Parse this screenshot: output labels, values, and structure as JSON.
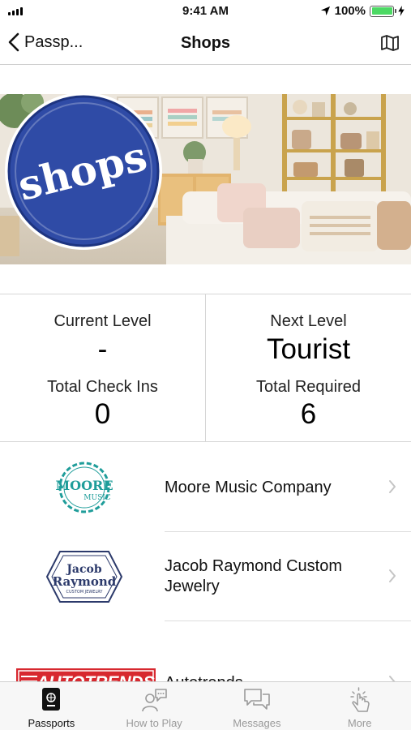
{
  "status_bar": {
    "time": "9:41 AM",
    "battery": "100%",
    "battery_level": 1.0
  },
  "nav": {
    "back_label": "Passp...",
    "title": "Shops",
    "map_icon": "map-icon"
  },
  "banner": {
    "badge_text": "shops",
    "badge_color": "#2f4ba6"
  },
  "stats": {
    "current_level_label": "Current Level",
    "current_level_value": "-",
    "next_level_label": "Next Level",
    "next_level_value": "Tourist",
    "total_checkins_label": "Total Check Ins",
    "total_checkins_value": "0",
    "total_required_label": "Total Required",
    "total_required_value": "6"
  },
  "shops": [
    {
      "name": "Moore Music Company",
      "logo_word_1": "MOORE",
      "logo_word_2": "MUSIC",
      "logo_color": "#1f9d9a"
    },
    {
      "name": "Jacob Raymond Custom Jewelry",
      "logo_word_1": "Jacob",
      "logo_word_2": "Raymond",
      "logo_word_3": "CUSTOM JEWELRY",
      "logo_color": "#2c3a6b"
    },
    {
      "name": "Autotrends",
      "logo_word_1": "AUTOTRENDS",
      "logo_color": "#d7282f"
    }
  ],
  "tabs": [
    {
      "label": "Passports",
      "icon": "passport-icon",
      "active": true
    },
    {
      "label": "How to Play",
      "icon": "help-chat-icon",
      "active": false
    },
    {
      "label": "Messages",
      "icon": "messages-icon",
      "active": false
    },
    {
      "label": "More",
      "icon": "tap-hand-icon",
      "active": false
    }
  ]
}
